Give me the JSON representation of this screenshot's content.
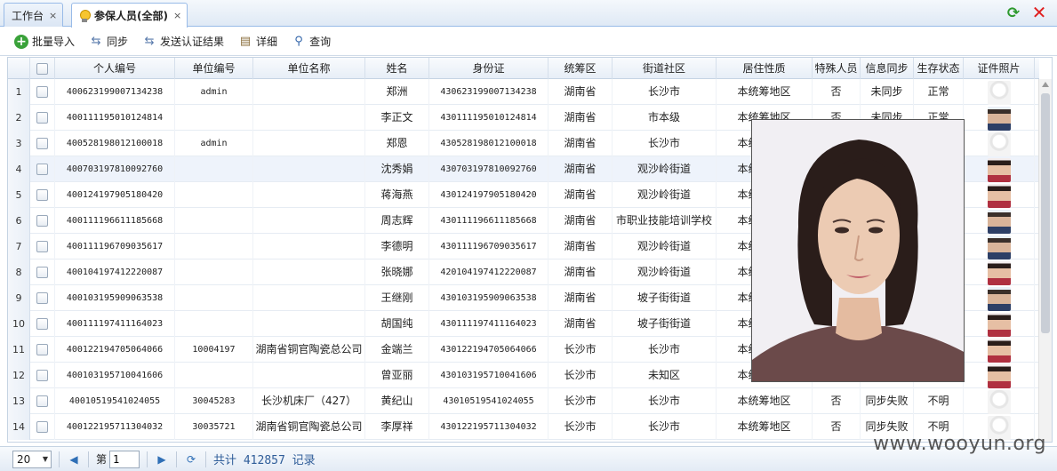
{
  "tabs": [
    {
      "label": "工作台",
      "active": false
    },
    {
      "label": "参保人员(全部)",
      "active": true
    }
  ],
  "tab_close_glyph": "×",
  "icons": {
    "refresh": "refresh-icon",
    "close_all": "close-icon"
  },
  "toolbar": {
    "import_label": "批量导入",
    "sync_label": "同步",
    "send_label": "发送认证结果",
    "detail_label": "详细",
    "query_label": "查询"
  },
  "columns": [
    "个人编号",
    "单位编号",
    "单位名称",
    "姓名",
    "身份证",
    "统筹区",
    "街道社区",
    "居住性质",
    "特殊人员",
    "信息同步",
    "生存状态",
    "证件照片"
  ],
  "rows": [
    {
      "n": "1",
      "pid": "400623199007134238",
      "uid": "admin",
      "uname": "",
      "name": "郑洲",
      "idc": "430623199007134238",
      "area": "湖南省",
      "street": "长沙市",
      "res": "本统筹地区",
      "special": "否",
      "sync": "未同步",
      "life": "正常",
      "photo": "blank",
      "selected": false
    },
    {
      "n": "2",
      "pid": "400111195010124814",
      "uid": "",
      "uname": "",
      "name": "李正文",
      "idc": "430111195010124814",
      "area": "湖南省",
      "street": "市本级",
      "res": "本统筹地区",
      "special": "否",
      "sync": "未同步",
      "life": "正常",
      "photo": "man",
      "selected": false
    },
    {
      "n": "3",
      "pid": "400528198012100018",
      "uid": "admin",
      "uname": "",
      "name": "郑恩",
      "idc": "430528198012100018",
      "area": "湖南省",
      "street": "长沙市",
      "res": "本统筹地区",
      "special": "",
      "sync": "",
      "life": "",
      "photo": "blank",
      "selected": false
    },
    {
      "n": "4",
      "pid": "400703197810092760",
      "uid": "",
      "uname": "",
      "name": "沈秀娟",
      "idc": "430703197810092760",
      "area": "湖南省",
      "street": "观沙岭街道",
      "res": "本统筹地区",
      "special": "",
      "sync": "",
      "life": "",
      "photo": "woman",
      "selected": true
    },
    {
      "n": "5",
      "pid": "400124197905180420",
      "uid": "",
      "uname": "",
      "name": "蒋海燕",
      "idc": "430124197905180420",
      "area": "湖南省",
      "street": "观沙岭街道",
      "res": "本统筹地区",
      "special": "",
      "sync": "",
      "life": "",
      "photo": "woman",
      "selected": false
    },
    {
      "n": "6",
      "pid": "400111196611185668",
      "uid": "",
      "uname": "",
      "name": "周志辉",
      "idc": "430111196611185668",
      "area": "湖南省",
      "street": "市职业技能培训学校",
      "res": "本统筹地区",
      "special": "",
      "sync": "",
      "life": "",
      "photo": "man",
      "selected": false
    },
    {
      "n": "7",
      "pid": "400111196709035617",
      "uid": "",
      "uname": "",
      "name": "李德明",
      "idc": "430111196709035617",
      "area": "湖南省",
      "street": "观沙岭街道",
      "res": "本统筹地区",
      "special": "",
      "sync": "",
      "life": "",
      "photo": "man",
      "selected": false
    },
    {
      "n": "8",
      "pid": "400104197412220087",
      "uid": "",
      "uname": "",
      "name": "张晓娜",
      "idc": "420104197412220087",
      "area": "湖南省",
      "street": "观沙岭街道",
      "res": "本统筹地区",
      "special": "",
      "sync": "",
      "life": "",
      "photo": "woman",
      "selected": false
    },
    {
      "n": "9",
      "pid": "400103195909063538",
      "uid": "",
      "uname": "",
      "name": "王继刚",
      "idc": "430103195909063538",
      "area": "湖南省",
      "street": "坡子街街道",
      "res": "本统筹地区",
      "special": "",
      "sync": "",
      "life": "",
      "photo": "man",
      "selected": false
    },
    {
      "n": "10",
      "pid": "400111197411164023",
      "uid": "",
      "uname": "",
      "name": "胡国纯",
      "idc": "430111197411164023",
      "area": "湖南省",
      "street": "坡子街街道",
      "res": "本统筹地区",
      "special": "",
      "sync": "",
      "life": "",
      "photo": "woman",
      "selected": false
    },
    {
      "n": "11",
      "pid": "400122194705064066",
      "uid": "10004197",
      "uname": "湖南省铜官陶瓷总公司",
      "name": "金端兰",
      "idc": "430122194705064066",
      "area": "长沙市",
      "street": "长沙市",
      "res": "本统筹地区",
      "special": "",
      "sync": "",
      "life": "",
      "photo": "woman",
      "selected": false
    },
    {
      "n": "12",
      "pid": "400103195710041606",
      "uid": "",
      "uname": "",
      "name": "曾亚丽",
      "idc": "430103195710041606",
      "area": "长沙市",
      "street": "未知区",
      "res": "本统筹地区",
      "special": "",
      "sync": "",
      "life": "",
      "photo": "woman",
      "selected": false
    },
    {
      "n": "13",
      "pid": "40010519541024055",
      "uid": "30045283",
      "uname": "长沙机床厂（427）",
      "name": "黄纪山",
      "idc": "43010519541024055",
      "area": "长沙市",
      "street": "长沙市",
      "res": "本统筹地区",
      "special": "否",
      "sync": "同步失败",
      "life": "不明",
      "photo": "blank",
      "selected": false
    },
    {
      "n": "14",
      "pid": "400122195711304032",
      "uid": "30035721",
      "uname": "湖南省铜官陶瓷总公司",
      "name": "李厚祥",
      "idc": "430122195711304032",
      "area": "长沙市",
      "street": "长沙市",
      "res": "本统筹地区",
      "special": "否",
      "sync": "同步失败",
      "life": "不明",
      "photo": "blank",
      "selected": false
    }
  ],
  "pager": {
    "page_size": "20",
    "page_label": "第",
    "page_value": "1",
    "total": "共计 412857 记录"
  },
  "watermark": "www.wooyun.org",
  "colors": {
    "accent": "#2f6fb6",
    "header_bg": "#e7eef7",
    "selected_row": "#eef3fb"
  }
}
